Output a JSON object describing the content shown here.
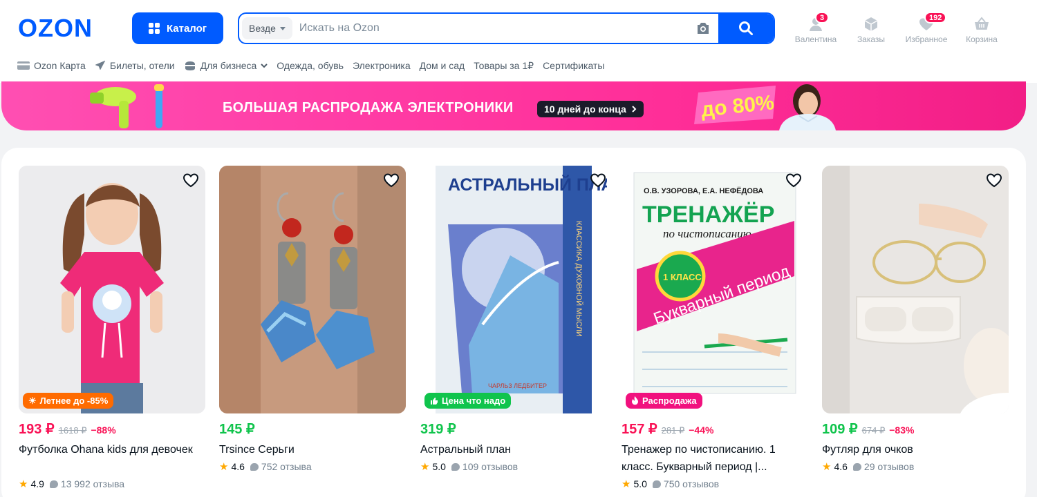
{
  "brand": {
    "logo_text": "OZON",
    "color": "#005bff"
  },
  "header": {
    "catalog_label": "Каталог",
    "search": {
      "scope": "Везде",
      "placeholder": "Искать на Ozon"
    },
    "nav": [
      {
        "label": "Валентина",
        "icon": "user-icon",
        "badge": "3"
      },
      {
        "label": "Заказы",
        "icon": "box-icon",
        "badge": ""
      },
      {
        "label": "Избранное",
        "icon": "heart-icon",
        "badge": "192"
      },
      {
        "label": "Корзина",
        "icon": "basket-icon",
        "badge": ""
      }
    ]
  },
  "quicklinks": [
    {
      "label": "Ozon Карта",
      "icon": "card-icon"
    },
    {
      "label": "Билеты, отели",
      "icon": "plane-icon"
    },
    {
      "label": "Для бизнеса",
      "icon": "business-icon",
      "dropdown": true
    },
    {
      "label": "Одежда, обувь"
    },
    {
      "label": "Электроника"
    },
    {
      "label": "Дом и сад"
    },
    {
      "label": "Товары за 1₽"
    },
    {
      "label": "Сертификаты"
    }
  ],
  "banner": {
    "title": "БОЛЬШАЯ РАСПРОДАЖА ЭЛЕКТРОНИКИ",
    "pill": "10 дней до конца",
    "promo": "до 80%"
  },
  "products": [
    {
      "price": "193 ₽",
      "old_price": "1618 ₽",
      "discount": "−88%",
      "price_color": "red",
      "title": "Футболка Ohana kids для девочек",
      "rating": "4.9",
      "reviews": "13 992 отзыва",
      "tag": "Летнее до -85%",
      "tag_color": "#ff6b00",
      "tag_icon": "sun-icon"
    },
    {
      "price": "145 ₽",
      "old_price": "",
      "discount": "",
      "price_color": "green",
      "title": "Trsince Серьги",
      "rating": "4.6",
      "reviews": "752 отзыва",
      "tag": "",
      "tag_color": "",
      "tag_icon": ""
    },
    {
      "price": "319 ₽",
      "old_price": "",
      "discount": "",
      "price_color": "green",
      "title": "Астральный план",
      "rating": "5.0",
      "reviews": "109 отзывов",
      "tag": "Цена что надо",
      "tag_color": "#10c44c",
      "tag_icon": "thumb-up-icon",
      "cover_title": "АСТРАЛЬНЫЙ ПЛАН",
      "cover_spine": "КЛАССИКА ДУХОВНОЙ МЫСЛИ",
      "cover_author": "ЧАРЛЬЗ ЛЕДБИТЕР"
    },
    {
      "price": "157 ₽",
      "old_price": "281 ₽",
      "discount": "−44%",
      "price_color": "red",
      "title": "Тренажер по чистописанию. 1 класс. Букварный период |...",
      "rating": "5.0",
      "reviews": "750 отзывов",
      "tag": "Распродажа",
      "tag_color": "#f1117e",
      "tag_icon": "fire-icon",
      "cover_authors": "О.В. УЗОРОВА, Е.А. НЕФЁДОВА",
      "cover_title": "ТРЕНАЖЁР",
      "cover_subtitle": "по чистописанию",
      "cover_grade": "1 КЛАСС",
      "cover_band": "Букварный период"
    },
    {
      "price": "109 ₽",
      "old_price": "674 ₽",
      "discount": "−83%",
      "price_color": "red",
      "title": "Футляр для очков",
      "rating": "4.6",
      "reviews": "29 отзывов",
      "tag": "",
      "tag_color": "",
      "tag_icon": ""
    }
  ]
}
